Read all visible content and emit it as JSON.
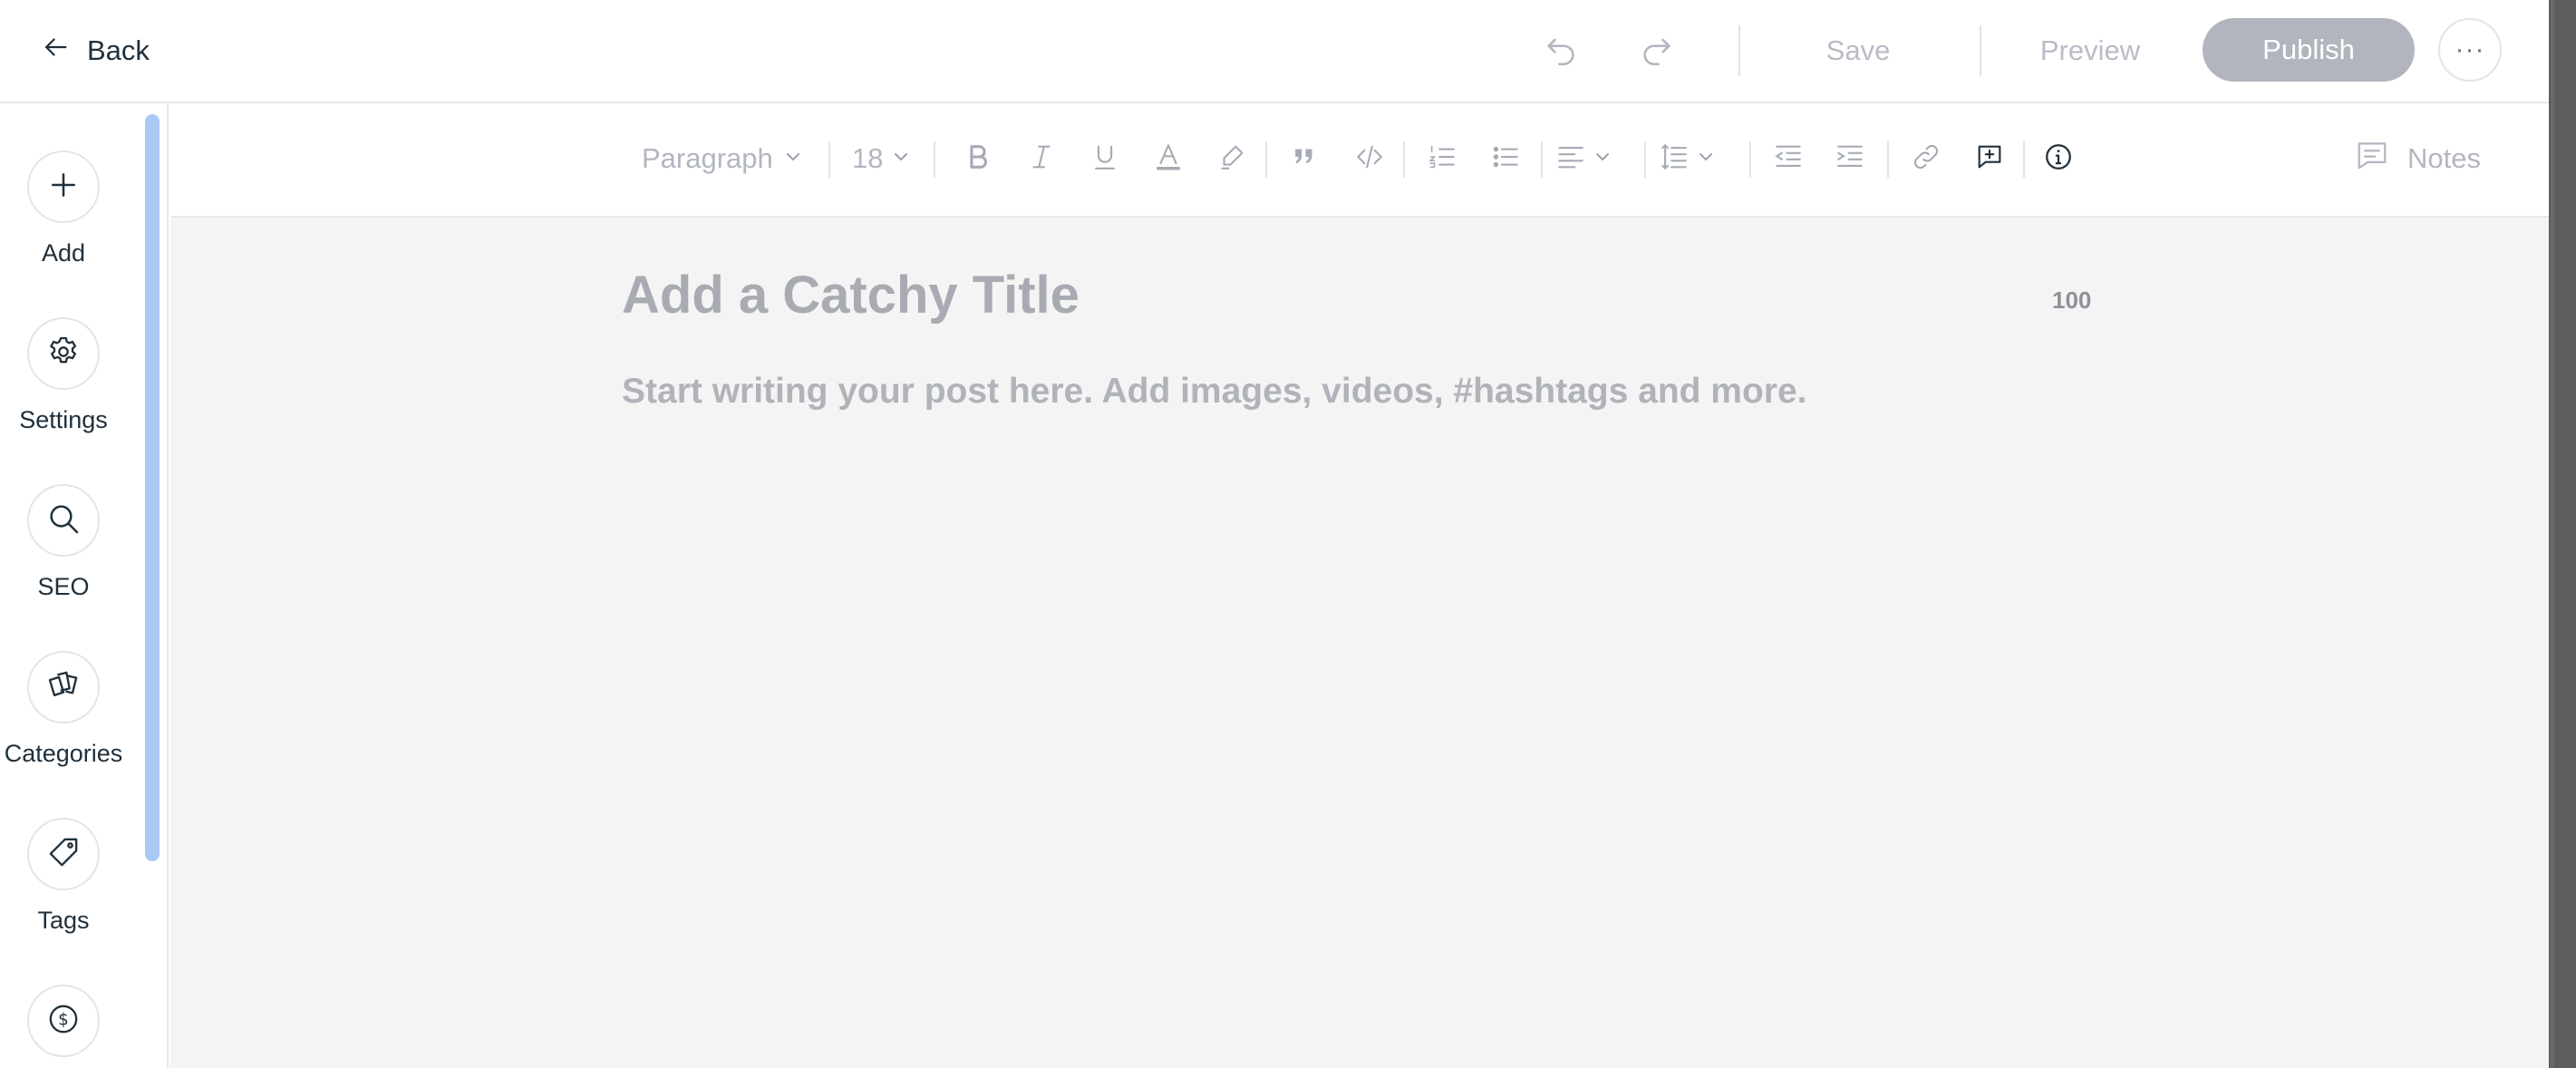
{
  "header": {
    "back_label": "Back",
    "save_label": "Save",
    "preview_label": "Preview",
    "publish_label": "Publish",
    "more_label": "···",
    "icons": {
      "back": "arrow-left-icon",
      "undo": "undo-icon",
      "redo": "redo-icon",
      "more": "ellipsis-icon"
    }
  },
  "sidebar": {
    "items": [
      {
        "label": "Add",
        "icon": "plus-icon"
      },
      {
        "label": "Settings",
        "icon": "gear-icon"
      },
      {
        "label": "SEO",
        "icon": "search-icon"
      },
      {
        "label": "Categories",
        "icon": "cards-icon"
      },
      {
        "label": "Tags",
        "icon": "tag-icon"
      },
      {
        "label": "",
        "icon": "dollar-icon"
      }
    ]
  },
  "toolbar": {
    "paragraph_style": "Paragraph",
    "font_size": "18",
    "notes_label": "Notes",
    "tools": [
      "bold-icon",
      "italic-icon",
      "underline-icon",
      "text-color-icon",
      "highlight-icon",
      "quote-icon",
      "code-icon",
      "ordered-list-icon",
      "bulleted-list-icon",
      "align-icon",
      "line-spacing-icon",
      "decrease-indent-icon",
      "increase-indent-icon",
      "link-icon",
      "add-comment-icon",
      "info-icon"
    ]
  },
  "editor": {
    "title_placeholder": "Add a Catchy Title",
    "title_char_limit": "100",
    "body_placeholder": "Start writing your post here. Add images, videos, #hashtags and more."
  },
  "colors": {
    "publish_button": "#b2b4be",
    "sidebar_scrollbar": "#a9c9f7",
    "canvas_background": "#f4f4f4",
    "placeholder_text": "#a9abb3"
  }
}
